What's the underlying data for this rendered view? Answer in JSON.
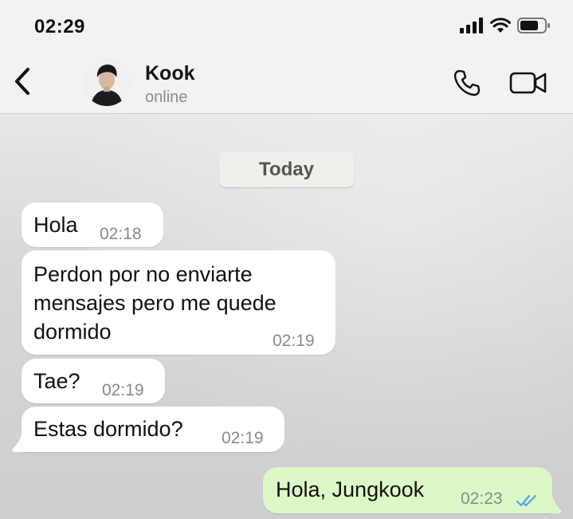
{
  "status_bar": {
    "time": "02:29",
    "icons": [
      "signal-icon",
      "wifi-icon",
      "battery-icon"
    ]
  },
  "header": {
    "back_icon": "chevron-left-icon",
    "contact_name": "Kook",
    "contact_status": "online",
    "actions": [
      "phone-icon",
      "video-camera-icon"
    ]
  },
  "chat": {
    "date_label": "Today",
    "messages": [
      {
        "direction": "in",
        "lines": [
          "Hola"
        ],
        "time": "02:18"
      },
      {
        "direction": "in",
        "lines": [
          "Perdon por no enviarte",
          "mensajes pero me quede",
          "dormido"
        ],
        "time": "02:19"
      },
      {
        "direction": "in",
        "lines": [
          "Tae?"
        ],
        "time": "02:19"
      },
      {
        "direction": "in",
        "lines": [
          "Estas dormido?"
        ],
        "time": "02:19"
      },
      {
        "direction": "out",
        "lines": [
          "Hola, Jungkook"
        ],
        "time": "02:23",
        "status": "read",
        "status_icon": "double-check-icon"
      }
    ]
  },
  "colors": {
    "outgoing_bubble": "#dcf8c6",
    "incoming_bubble": "#ffffff",
    "read_check": "#4fa8e8",
    "header_bg": "#f2f2f2"
  }
}
